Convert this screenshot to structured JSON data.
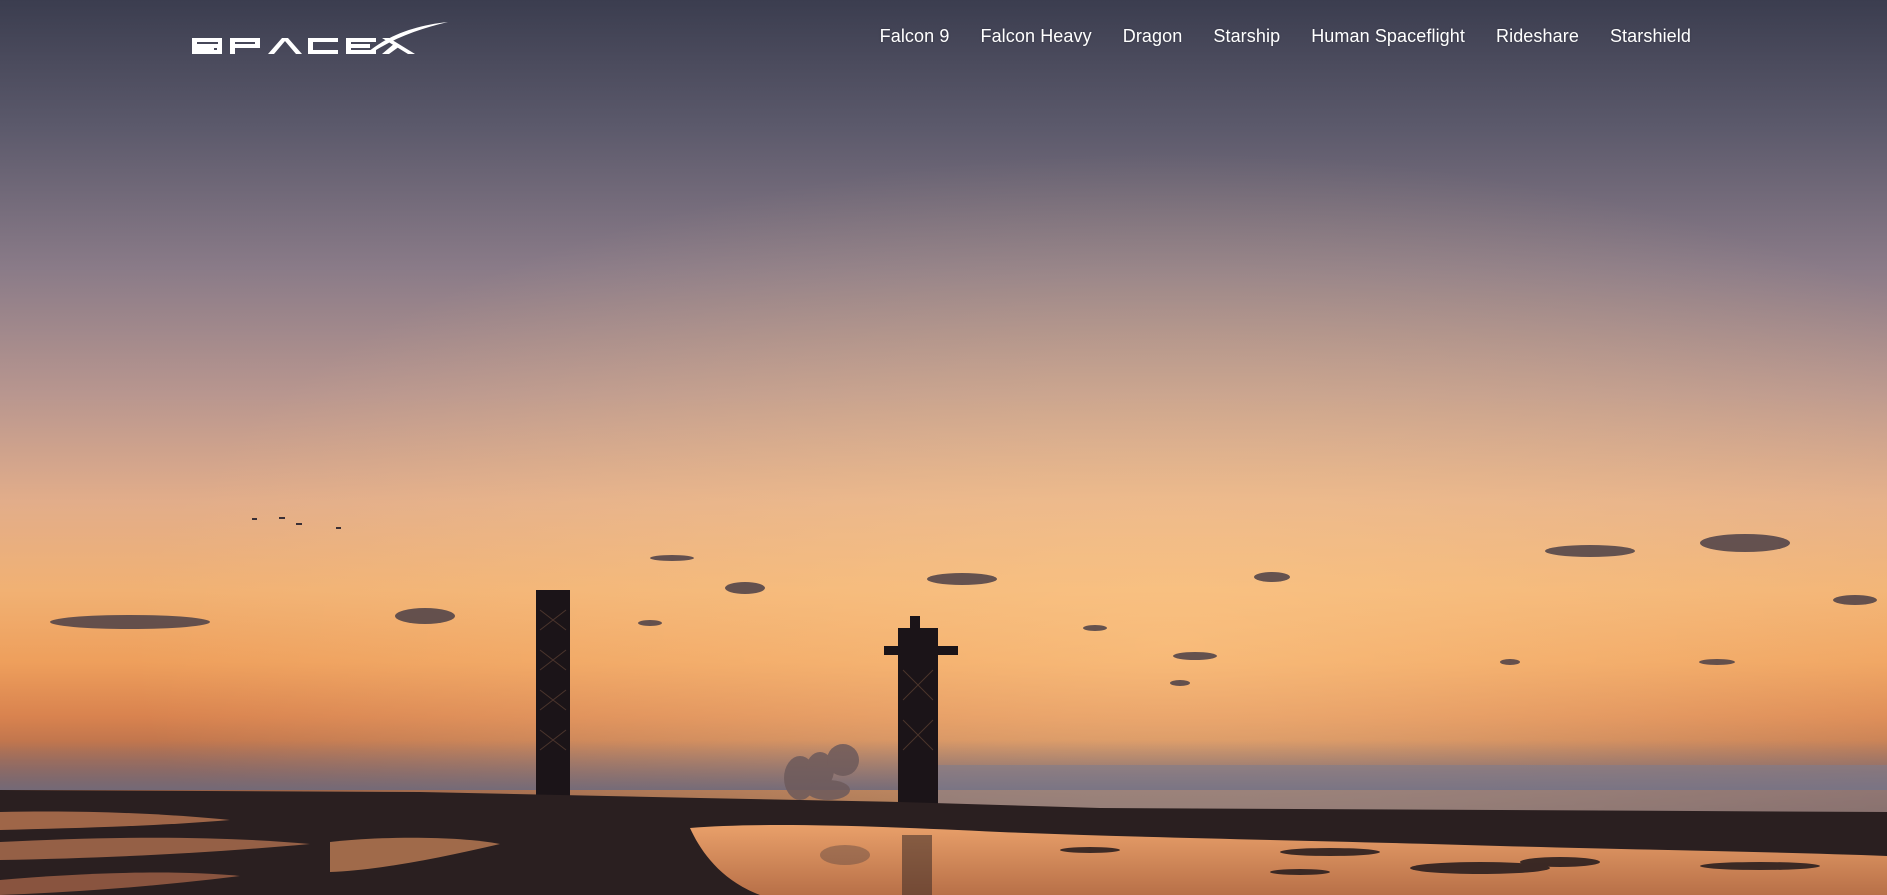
{
  "brand": {
    "logo_text": "SPACEX",
    "logo_color": "#ffffff"
  },
  "nav": {
    "items": [
      {
        "label": "Falcon 9"
      },
      {
        "label": "Falcon Heavy"
      },
      {
        "label": "Dragon"
      },
      {
        "label": "Starship"
      },
      {
        "label": "Human Spaceflight"
      },
      {
        "label": "Rideshare"
      },
      {
        "label": "Starshield"
      }
    ]
  },
  "hero": {
    "media": "sunset-launch-site-video",
    "sky_colors": [
      "#3d3f52",
      "#8a7c8a",
      "#d9a588",
      "#f2b070",
      "#e58f4d"
    ]
  }
}
